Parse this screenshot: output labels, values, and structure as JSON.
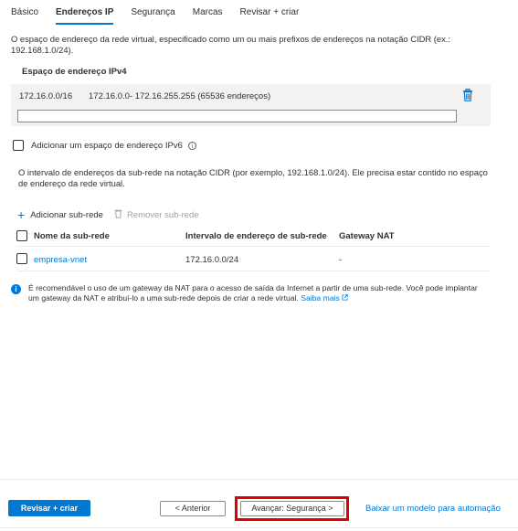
{
  "tabs": [
    {
      "label": "Básico"
    },
    {
      "label": "Endereços IP"
    },
    {
      "label": "Segurança"
    },
    {
      "label": "Marcas"
    },
    {
      "label": "Revisar + criar"
    }
  ],
  "active_tab": "Endereços IP",
  "intro_text": "O espaço de endereço da rede virtual, especificado como um ou mais prefixos de endereços na notação CIDR (ex.: 192.168.1.0/24).",
  "ipv4": {
    "header": "Espaço de endereço IPv4",
    "cidr": "172.16.0.0/16",
    "range": "172.16.0.0- 172.16.255.255 (65536 endereços)",
    "input_value": ""
  },
  "ipv6": {
    "label": "Adicionar um espaço de endereço IPv6",
    "checked": false
  },
  "subnet_description": "O intervalo de endereços da sub-rede na notação CIDR (por exemplo, 192.168.1.0/24). Ele precisa estar contido no espaço de endereço da rede virtual.",
  "actions": {
    "add": "Adicionar sub-rede",
    "remove": "Remover sub-rede"
  },
  "table": {
    "columns": [
      "Nome da sub-rede",
      "Intervalo de endereço de sub-rede",
      "Gateway NAT"
    ],
    "rows": [
      {
        "name": "empresa-vnet",
        "range": "172.16.0.0/24",
        "nat": "-"
      }
    ]
  },
  "notice": {
    "text": "É recomendável o uso de um gateway da NAT para o acesso de saída da Internet a partir de uma sub-rede. Você pode implantar um gateway da NAT e atribuí-lo a uma sub-rede depois de criar a rede virtual.",
    "link": "Saiba mais"
  },
  "footer": {
    "review_button": "Revisar + criar",
    "prev_button": "< Anterior",
    "next_button": "Avançar: Segurança >",
    "automation_link": "Baixar um modelo para automação"
  },
  "colors": {
    "accent": "#0078d4",
    "highlight": "#e00000"
  },
  "icons": [
    "trash-icon",
    "info-icon",
    "plus-icon",
    "external-link-icon"
  ]
}
